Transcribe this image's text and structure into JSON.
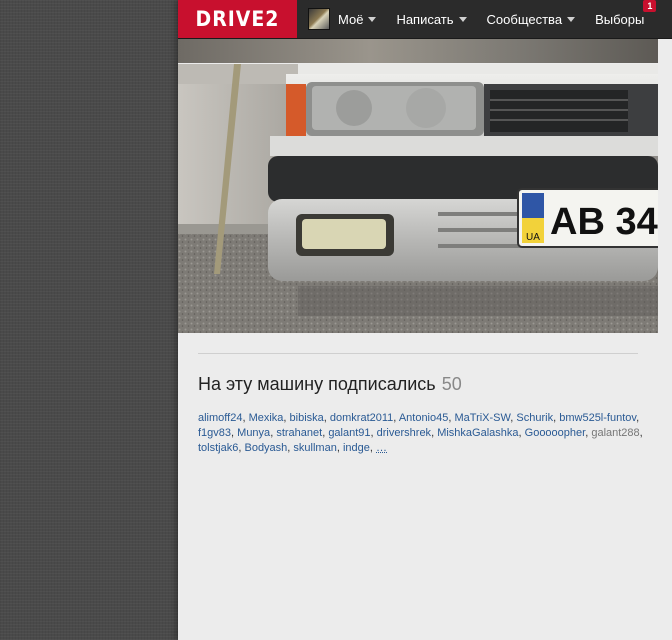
{
  "header": {
    "logo": "DRIVE2",
    "nav": [
      {
        "label": "Моё",
        "has_caret": true
      },
      {
        "label": "Написать",
        "has_caret": true
      },
      {
        "label": "Сообщества",
        "has_caret": true
      },
      {
        "label": "Выборы",
        "has_caret": false,
        "badge": "1"
      }
    ],
    "avatar_icon": "user-avatar-icon"
  },
  "photo": {
    "license_plate_region": "UA",
    "license_plate_text": "AB 34"
  },
  "subscribers": {
    "title": "На эту машину подписались",
    "count": "50",
    "names": [
      "alimoff24",
      "Mexika",
      "bibiska",
      "domkrat2011",
      "Antonio45",
      "MaTriX-SW",
      "Schurik",
      "bmw525l-funtov",
      "f1gv83",
      "Munya",
      "strahanet",
      "galant91",
      "drivershrek",
      "MishkaGalashka",
      "Gooooopher",
      "galant288",
      "tolstjak6",
      "Bodyash",
      "skullman",
      "indge"
    ],
    "gray_names": [
      "galant288"
    ],
    "more": "…"
  },
  "colors": {
    "brand_red": "#c8102e",
    "nav_bg": "#2b2b2b",
    "link_blue": "#2a5a94",
    "page_bg": "#ececec"
  }
}
